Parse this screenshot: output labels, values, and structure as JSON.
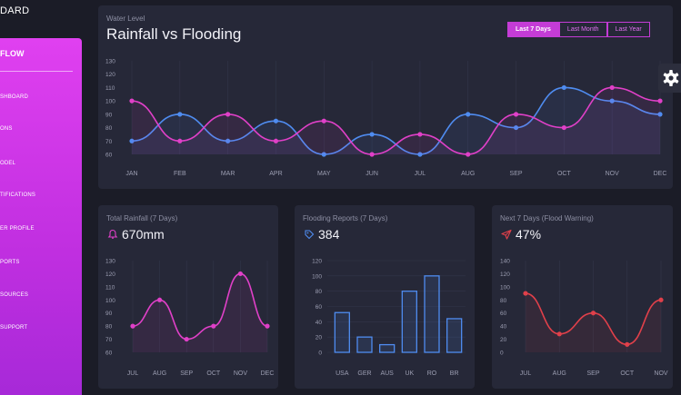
{
  "app": {
    "brand": "DARD"
  },
  "sidebar": {
    "title": "FLOW",
    "items": [
      {
        "label": "SHBOARD"
      },
      {
        "label": "ONS"
      },
      {
        "label": "ODEL"
      },
      {
        "label": "TIFICATIONS"
      },
      {
        "label": "ER PROFILE"
      },
      {
        "label": "PORTS"
      },
      {
        "label": "SOURCES"
      },
      {
        "label": "SUPPORT"
      }
    ]
  },
  "header_card": {
    "subtitle": "Water Level",
    "title": "Rainfall vs Flooding",
    "ranges": [
      "Last 7 Days",
      "Last Month",
      "Last Year"
    ],
    "active_range": "Last 7 Days"
  },
  "cards": {
    "rainfall": {
      "subtitle": "Total Rainfall (7 Days)",
      "value": "670mm",
      "icon": "bell-icon"
    },
    "flooding": {
      "subtitle": "Flooding Reports (7 Days)",
      "value": "384",
      "icon": "tag-icon"
    },
    "warning": {
      "subtitle": "Next 7 Days (Flood Warning)",
      "value": "47%",
      "icon": "send-icon"
    }
  },
  "colors": {
    "accent": "#c43cd6",
    "pink": "#e040c8",
    "blue": "#4f8cf0",
    "red": "#e0404a",
    "card": "#262838",
    "bg": "#1b1c27"
  },
  "chart_data": [
    {
      "type": "line",
      "title": "Rainfall vs Flooding",
      "categories": [
        "JAN",
        "FEB",
        "MAR",
        "APR",
        "MAY",
        "JUN",
        "JUL",
        "AUG",
        "SEP",
        "OCT",
        "NOV",
        "DEC"
      ],
      "series": [
        {
          "values": [
            70,
            90,
            70,
            85,
            60,
            75,
            60,
            90,
            80,
            110,
            100,
            90
          ]
        },
        {
          "values": [
            100,
            70,
            90,
            70,
            85,
            60,
            75,
            60,
            90,
            80,
            110,
            100
          ]
        }
      ],
      "yticks": [
        60,
        70,
        80,
        90,
        100,
        110,
        120,
        130
      ],
      "ylim": [
        60,
        130
      ]
    },
    {
      "type": "line",
      "categories": [
        "JUL",
        "AUG",
        "SEP",
        "OCT",
        "NOV",
        "DEC"
      ],
      "series": [
        {
          "values": [
            80,
            100,
            70,
            80,
            120,
            80
          ]
        }
      ],
      "yticks": [
        60,
        70,
        80,
        90,
        100,
        110,
        120,
        130
      ],
      "ylim": [
        60,
        130
      ]
    },
    {
      "type": "bar",
      "categories": [
        "USA",
        "GER",
        "AUS",
        "UK",
        "RO",
        "BR"
      ],
      "values": [
        52,
        20,
        10,
        80,
        100,
        44
      ],
      "yticks": [
        0,
        20,
        40,
        60,
        80,
        100,
        120
      ],
      "ylim": [
        0,
        120
      ]
    },
    {
      "type": "line",
      "categories": [
        "JUL",
        "AUG",
        "SEP",
        "OCT",
        "NOV"
      ],
      "series": [
        {
          "values": [
            90,
            28,
            60,
            12,
            80
          ]
        }
      ],
      "yticks": [
        0,
        20,
        40,
        60,
        80,
        100,
        120,
        140
      ],
      "ylim": [
        0,
        140
      ]
    }
  ]
}
